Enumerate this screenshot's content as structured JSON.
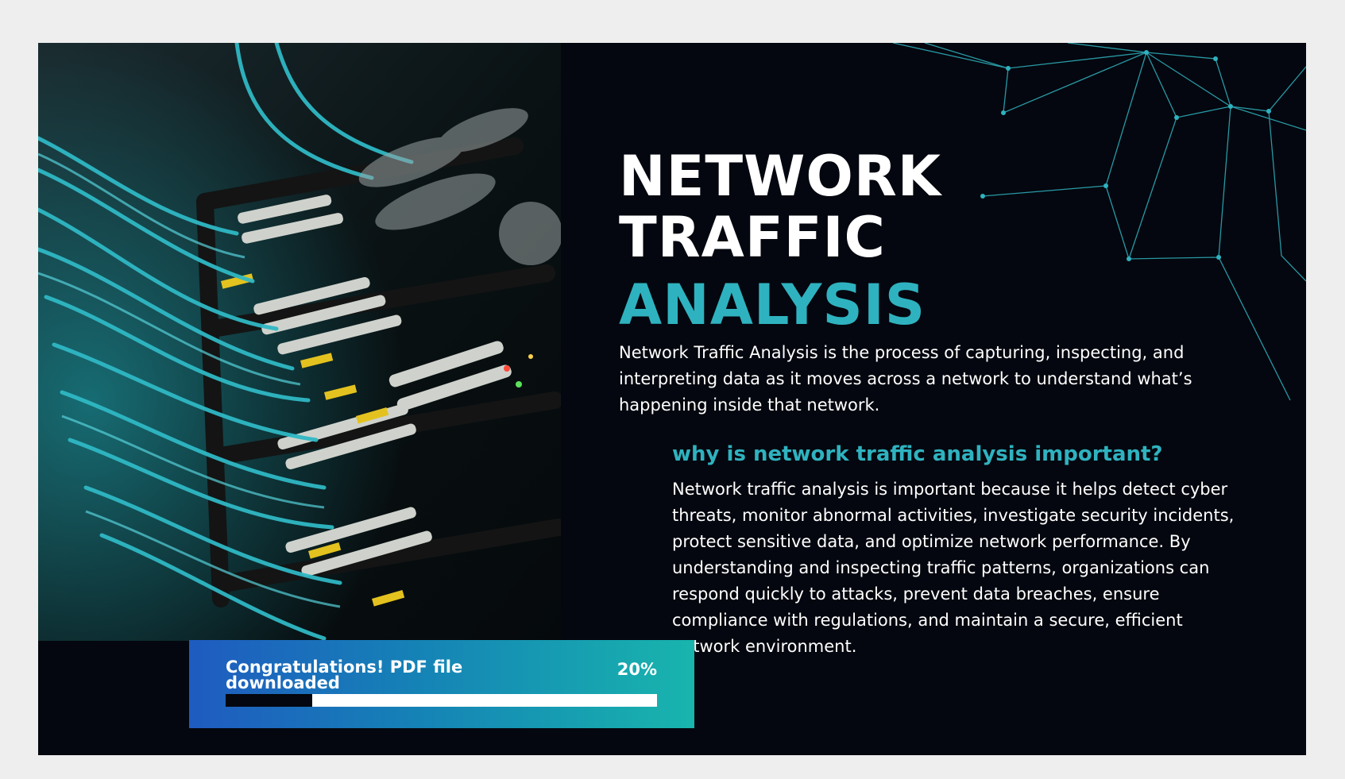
{
  "slide": {
    "title_line1": "NETWORK",
    "title_line2": "TRAFFIC",
    "title_line3": "ANALYSIS",
    "intro": "Network Traffic Analysis is the process of capturing, inspecting, and interpreting data as it moves across a network to understand what’s happening inside that network.",
    "subheading": "why is network traffic analysis important?",
    "body": "Network traffic analysis is important because it helps detect cyber threats, monitor abnormal activities, investigate security incidents, protect sensitive data, and optimize network performance. By understanding and inspecting traffic patterns, organizations can respond quickly to attacks, prevent data breaches, ensure compliance with regulations, and maintain a secure, efficient network environment."
  },
  "toast": {
    "message": "Congratulations! PDF file downloaded",
    "percent_label": "20%",
    "progress": 0.2
  },
  "colors": {
    "background": "#04070f",
    "accent": "#2fb2bf",
    "toast_start": "#1f5bc0",
    "toast_end": "#18b5ad"
  }
}
